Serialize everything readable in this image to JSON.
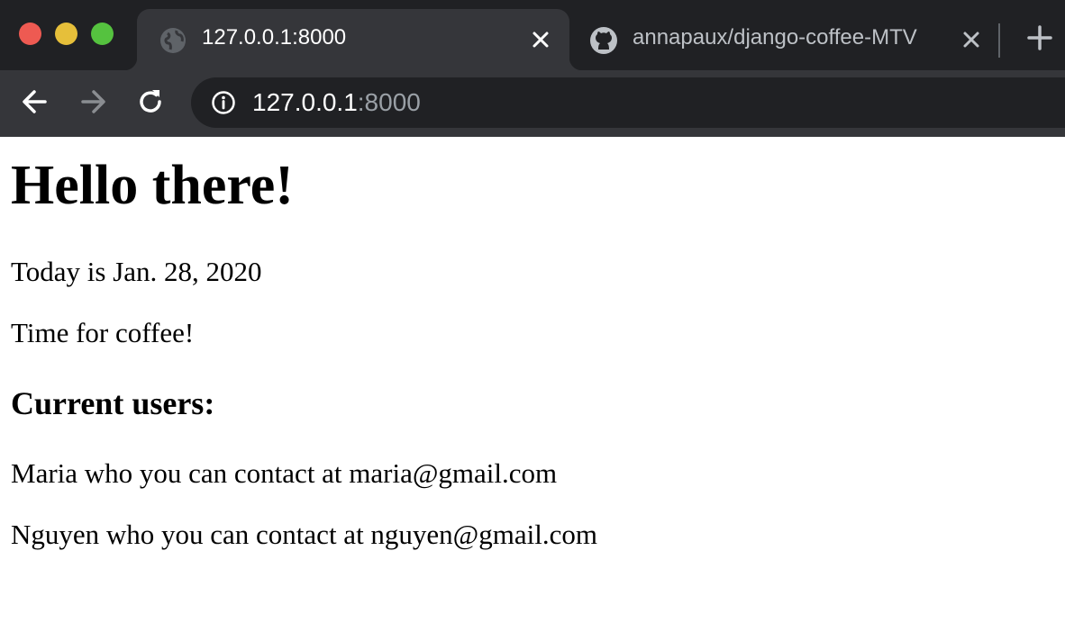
{
  "browser": {
    "tabs": [
      {
        "title": "127.0.0.1:8000",
        "active": true,
        "icon": "globe-icon"
      },
      {
        "title": "annapaux/django-coffee-MTV",
        "active": false,
        "icon": "github-icon"
      }
    ],
    "address": {
      "host": "127.0.0.1",
      "port": ":8000"
    }
  },
  "page": {
    "heading": "Hello there!",
    "date_line": "Today is Jan. 28, 2020",
    "message": "Time for coffee!",
    "users_heading": "Current users:",
    "users": [
      "Maria who you can contact at maria@gmail.com",
      "Nguyen who you can contact at nguyen@gmail.com"
    ]
  },
  "colors": {
    "titlebar": "#202124",
    "toolbar": "#35363a",
    "close_red": "#ee5a52",
    "minimize_yellow": "#e6bf3a",
    "zoom_green": "#55c23f"
  }
}
